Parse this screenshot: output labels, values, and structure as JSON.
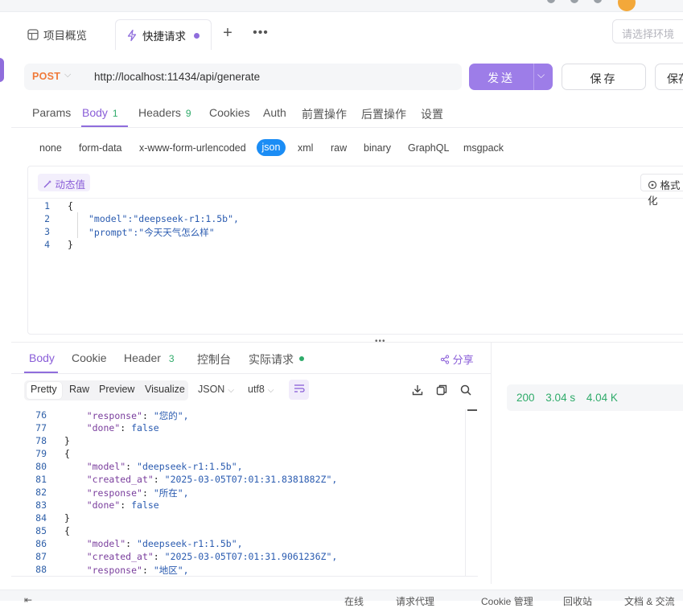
{
  "tabs": {
    "overview": "项目概览",
    "quick_request": "快捷请求"
  },
  "env": {
    "placeholder": "请选择环境"
  },
  "request": {
    "method": "POST",
    "url": "http://localhost:11434/api/generate",
    "send": "发送",
    "save": "保存",
    "save2": "保存"
  },
  "req_tabs": {
    "params": "Params",
    "body": "Body",
    "body_count": "1",
    "headers": "Headers",
    "headers_count": "9",
    "cookies": "Cookies",
    "auth": "Auth",
    "pre": "前置操作",
    "post": "后置操作",
    "settings": "设置"
  },
  "body_types": [
    "none",
    "form-data",
    "x-www-form-urlencoded",
    "json",
    "xml",
    "raw",
    "binary",
    "GraphQL",
    "msgpack"
  ],
  "editor": {
    "dynamic_value": "动态值",
    "format": "格式化",
    "lines": [
      "1",
      "2",
      "3",
      "4"
    ],
    "code": [
      "{",
      "\"model\":\"deepseek-r1:1.5b\",",
      "\"prompt\":\"今天天气怎么样\"",
      "}"
    ]
  },
  "resp_tabs": {
    "body": "Body",
    "cookie": "Cookie",
    "header": "Header",
    "header_count": "3",
    "console": "控制台",
    "actual": "实际请求",
    "share": "分享"
  },
  "view": {
    "pretty": "Pretty",
    "raw": "Raw",
    "preview": "Preview",
    "visualize": "Visualize",
    "format": "JSON",
    "encoding": "utf8"
  },
  "response": {
    "lines": [
      "76",
      "77",
      "78",
      "79",
      "80",
      "81",
      "82",
      "83",
      "84",
      "85",
      "86",
      "87",
      "88"
    ],
    "code": [
      "    \"response\": \"您的\",",
      "    \"done\": false",
      "}",
      "{",
      "    \"model\": \"deepseek-r1:1.5b\",",
      "    \"created_at\": \"2025-03-05T07:01:31.8381882Z\",",
      "    \"response\": \"所在\",",
      "    \"done\": false",
      "}",
      "{",
      "    \"model\": \"deepseek-r1:1.5b\",",
      "    \"created_at\": \"2025-03-05T07:01:31.9061236Z\",",
      "    \"response\": \"地区\","
    ]
  },
  "status": {
    "code": "200",
    "time": "3.04 s",
    "size": "4.04 K"
  },
  "footer": {
    "online": "在线",
    "proxy": "请求代理",
    "cookie": "Cookie 管理",
    "recycle": "回收站",
    "docs": "文档 & 交流"
  },
  "colors": {
    "accent": "#8f6ddc",
    "method": "#f07a3a",
    "success": "#2fab6a",
    "json_pill": "#1b8df5"
  }
}
